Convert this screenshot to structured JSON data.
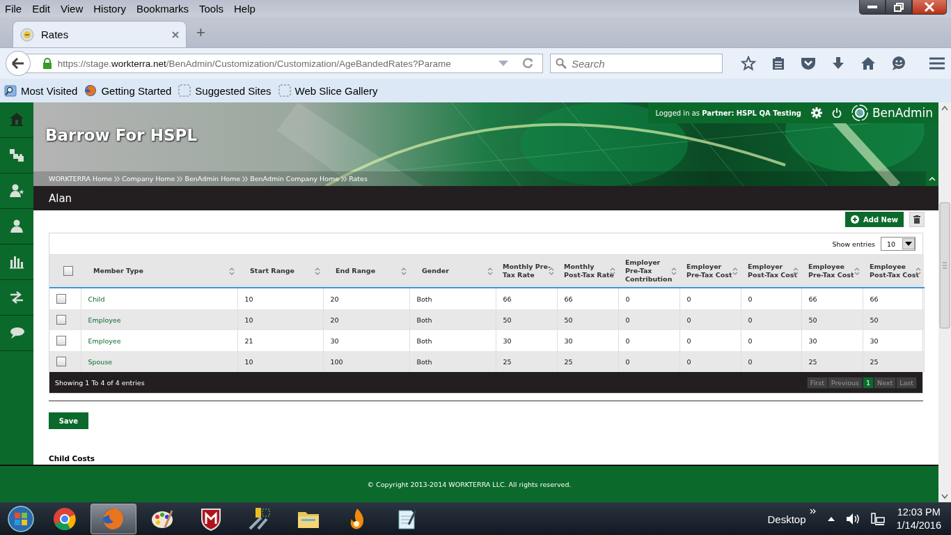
{
  "menu": [
    "File",
    "Edit",
    "View",
    "History",
    "Bookmarks",
    "Tools",
    "Help"
  ],
  "tabs": [
    {
      "label": "Rates",
      "selected": true
    }
  ],
  "new_tab": "+",
  "address_bar": {
    "scheme": "https://stage.",
    "domain": "workterra.net",
    "path": "/BenAdmin/Customization/Customization/AgeBandedRates?Parame"
  },
  "search": {
    "placeholder": "Search"
  },
  "bookmarks": [
    {
      "label": "Most Visited",
      "kind": "search"
    },
    {
      "label": "Getting Started",
      "kind": "fox"
    },
    {
      "label": "Suggested Sites",
      "kind": "dashed"
    },
    {
      "label": "Web Slice Gallery",
      "kind": "dashed"
    }
  ],
  "sidebar": {
    "items": [
      {
        "kind": "home"
      },
      {
        "kind": "puzzle"
      },
      {
        "kind": "person-star"
      },
      {
        "kind": "person"
      },
      {
        "kind": "chart"
      },
      {
        "kind": "arrows"
      },
      {
        "kind": "speech"
      }
    ]
  },
  "header": {
    "title": "Barrow For HSPL",
    "login_prefix": "Logged in as",
    "login_role": "Partner:",
    "login_name": "HSPL QA Testing",
    "brand": "BenAdmin"
  },
  "breadcrumbs": [
    "WORKTERRA Home",
    "Company Home",
    "BenAdmin Home",
    "BenAdmin Company Home",
    "Rates"
  ],
  "section_title": "Alan",
  "add_button": "Add New",
  "show_entries": {
    "label": "Show entries",
    "value": "10"
  },
  "table": {
    "header_checked": false,
    "columns": [
      "Member Type",
      "Start Range",
      "End Range",
      "Gender",
      "Monthly Pre-Tax Rate",
      "Monthly Post-Tax Rate",
      "Employer Pre-Tax Contribution",
      "Employer Pre-Tax Cost",
      "Employer Post-Tax Cost",
      "Employee Pre-Tax Cost",
      "Employee Post-Tax Cost"
    ],
    "rows": [
      {
        "checked": false,
        "cells": [
          "Child",
          "10",
          "20",
          "Both",
          "66",
          "66",
          "0",
          "0",
          "0",
          "66",
          "66"
        ]
      },
      {
        "checked": false,
        "cells": [
          "Employee",
          "10",
          "20",
          "Both",
          "50",
          "50",
          "0",
          "0",
          "0",
          "50",
          "50"
        ]
      },
      {
        "checked": false,
        "cells": [
          "Employee",
          "21",
          "30",
          "Both",
          "30",
          "30",
          "0",
          "0",
          "0",
          "30",
          "30"
        ]
      },
      {
        "checked": false,
        "cells": [
          "Spouse",
          "10",
          "100",
          "Both",
          "25",
          "25",
          "0",
          "0",
          "0",
          "25",
          "25"
        ]
      }
    ]
  },
  "table_info": "Showing 1 To 4 of 4 entries",
  "pagination": [
    {
      "label": "First",
      "selected": false
    },
    {
      "label": "Previous",
      "selected": false
    },
    {
      "label": "1",
      "selected": true
    },
    {
      "label": "Next",
      "selected": false
    },
    {
      "label": "Last",
      "selected": false
    }
  ],
  "save_button": "Save",
  "subheading": "Child Costs",
  "footer": "© Copyright 2013-2014 WORKTERRA LLC. All rights reserved.",
  "taskbar": {
    "apps": [
      {
        "kind": "chrome",
        "selected": false
      },
      {
        "kind": "fox",
        "selected": true
      },
      {
        "kind": "palette",
        "selected": false
      },
      {
        "kind": "shield",
        "selected": false
      },
      {
        "kind": "tools",
        "selected": false
      },
      {
        "kind": "folder",
        "selected": false
      },
      {
        "kind": "flame",
        "selected": false
      },
      {
        "kind": "notepad",
        "selected": false
      }
    ],
    "desktop_label": "Desktop",
    "time": "12:03 PM",
    "date": "1/14/2016"
  }
}
